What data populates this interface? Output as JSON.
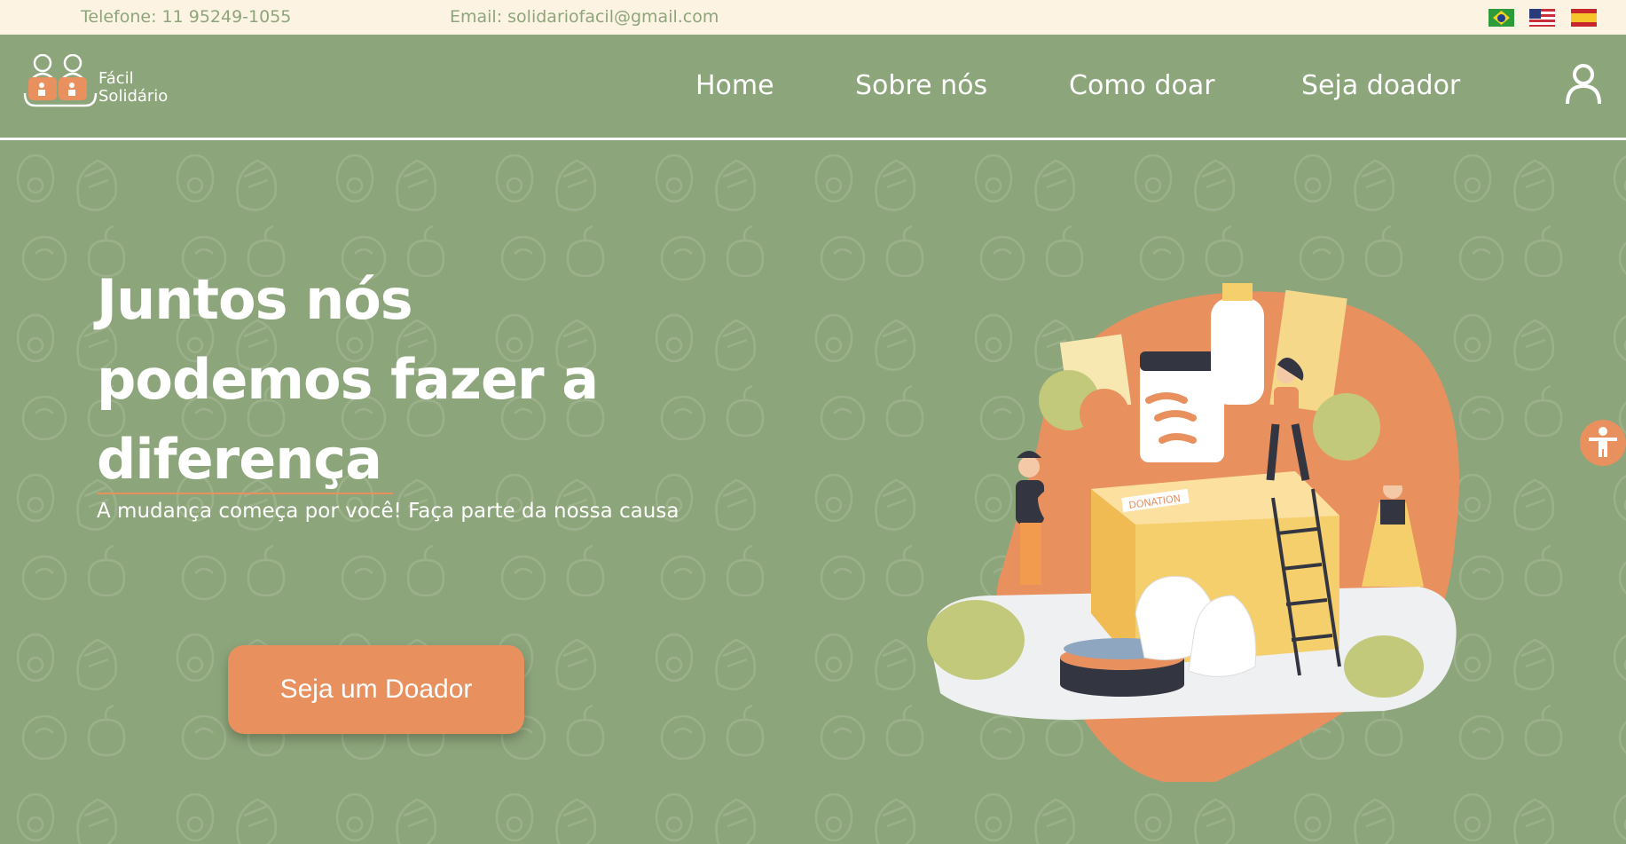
{
  "topbar": {
    "phone": "Telefone: 11 95249-1055",
    "email": "Email: solidariofacil@gmail.com",
    "languages": [
      {
        "name": "Português",
        "icon": "flag-brazil-icon"
      },
      {
        "name": "English",
        "icon": "flag-usa-icon"
      },
      {
        "name": "Español",
        "icon": "flag-spain-icon"
      }
    ]
  },
  "header": {
    "logo": {
      "line1": "Fácil",
      "line2": "Solidário"
    },
    "nav": {
      "home": "Home",
      "about": "Sobre nós",
      "how": "Como doar",
      "donor": "Seja doador"
    },
    "user_icon": "user-icon"
  },
  "hero": {
    "headline": "Juntos nós podemos fazer a diferença",
    "subtext": "A mudança começa por você! Faça parte da nossa causa",
    "cta": "Seja um Doador",
    "illustration_box_label": "DONATION",
    "illustration_icon": "donation-illustration-icon"
  },
  "accessibility": {
    "icon": "accessibility-icon"
  },
  "colors": {
    "primary_green": "#8da57b",
    "accent_orange": "#e9905f",
    "topbar_cream": "#fdf3e3",
    "white": "#ffffff"
  }
}
